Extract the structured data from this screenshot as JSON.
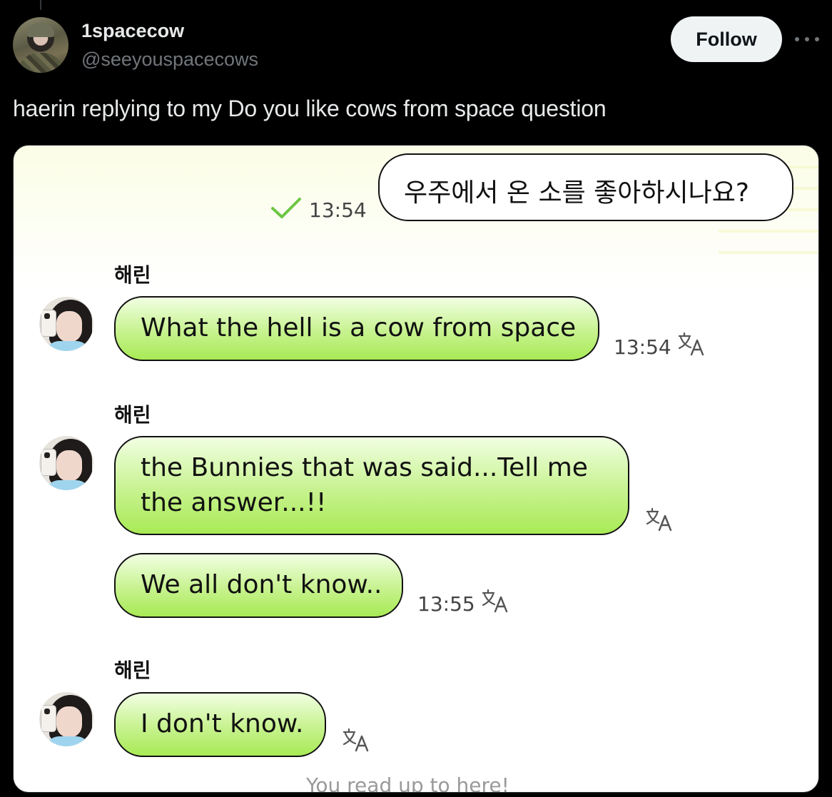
{
  "tweet": {
    "display_name": "1spacecow",
    "handle": "@seeyouspacecows",
    "follow_label": "Follow",
    "text": "haerin replying to my Do you like cows from space question"
  },
  "chat": {
    "outgoing": {
      "text": "우주에서 온 소를 좋아하시나요?",
      "time": "13:54"
    },
    "messages": [
      {
        "sender": "해린",
        "lines": [
          "What the hell is a cow from space"
        ],
        "time": "13:54"
      },
      {
        "sender": "해린",
        "lines": [
          "the Bunnies that was said...Tell me",
          "the answer...!!"
        ],
        "time": ""
      },
      {
        "sender": "",
        "lines": [
          "We all don't know.."
        ],
        "time": "13:55"
      },
      {
        "sender": "해린",
        "lines": [
          "I don't know."
        ],
        "time": ""
      }
    ],
    "footer": "You read up to here!"
  },
  "colors": {
    "incoming_bubble": "#b9ee74",
    "check": "#6cc644",
    "follow_bg": "#eff3f4"
  },
  "icons": [
    "more-icon",
    "check-icon",
    "translate-icon"
  ]
}
